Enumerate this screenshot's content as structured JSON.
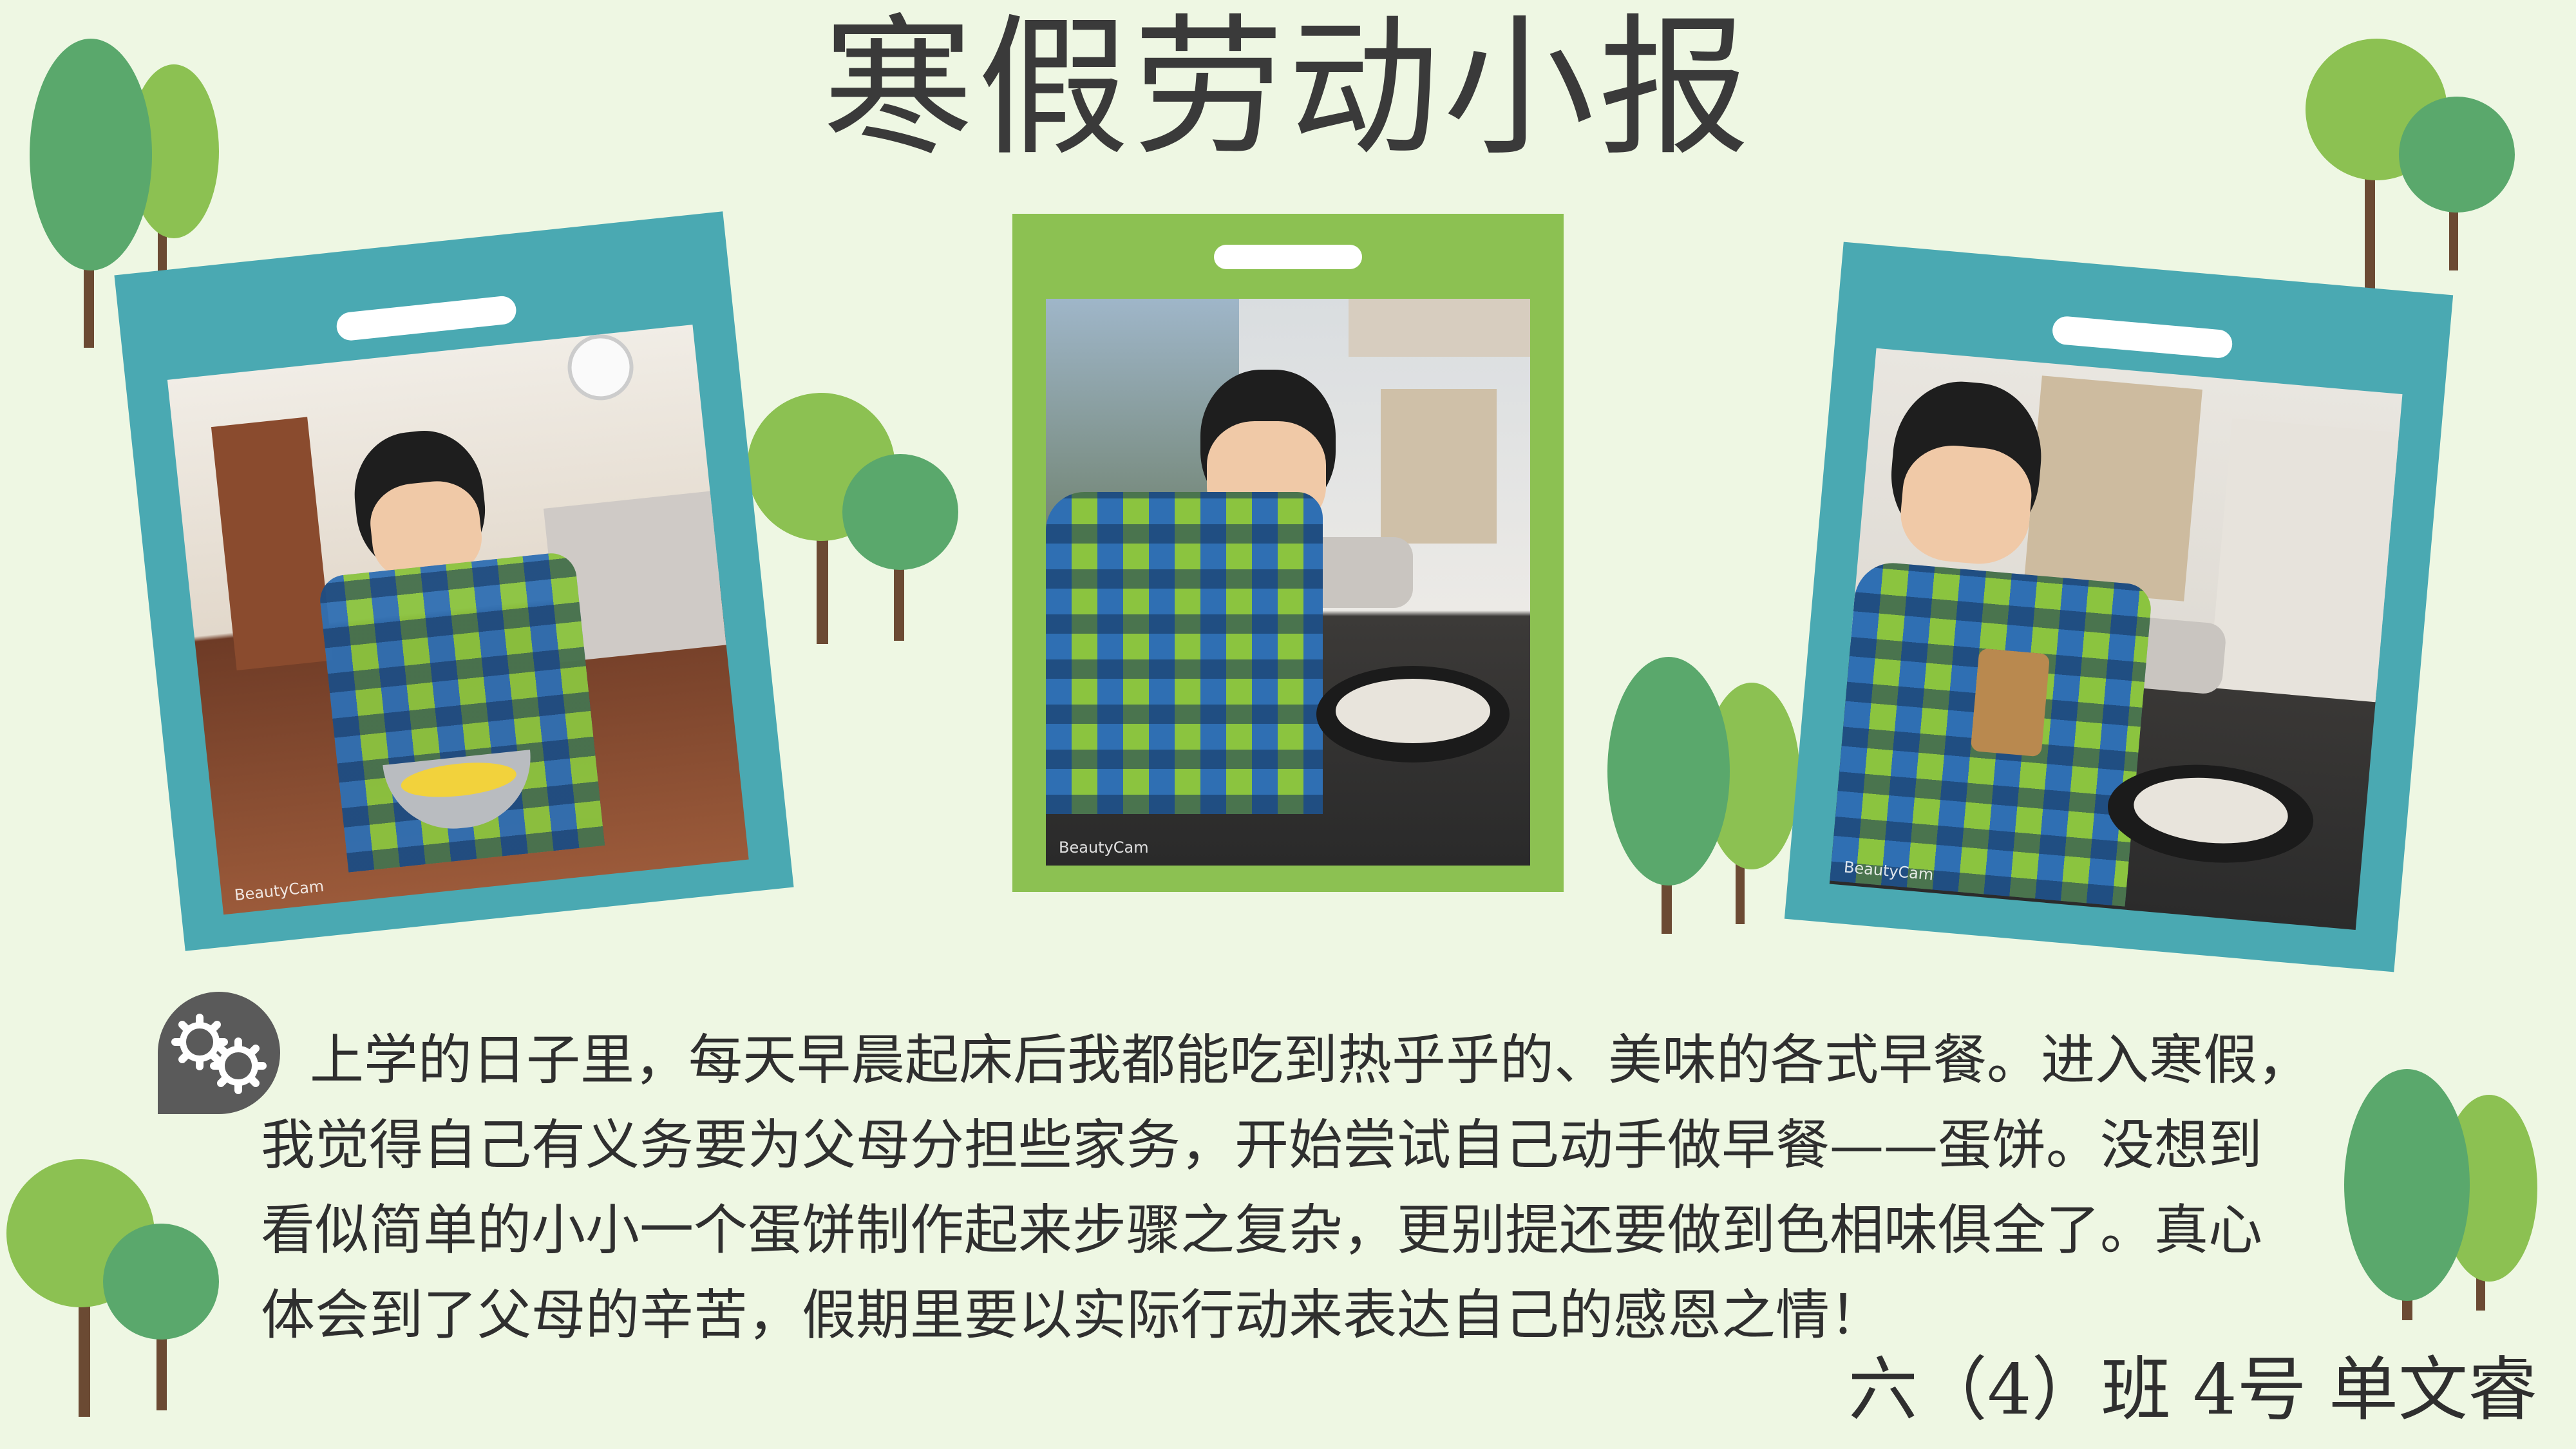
{
  "title": "寒假劳动小报",
  "paragraph": "上学的日子里，每天早晨起床后我都能吃到热乎乎的、美味的各式早餐。进入寒假，我觉得自己有义务要为父母分担些家务，开始尝试自己动手做早餐——蛋饼。没想到看似简单的小小一个蛋饼制作起来步骤之复杂，更别提还要做到色相味俱全了。真心体会到了父母的辛苦，假期里要以实际行动来表达自己的感恩之情！",
  "author": "六（4）班 4号 单文睿",
  "photos": [
    {
      "watermark": "BeautyCam",
      "frame_color": "#4aa9b2"
    },
    {
      "watermark": "BeautyCam",
      "frame_color": "#8cc152"
    },
    {
      "watermark": "BeautyCam",
      "frame_color": "#4aa9b2"
    }
  ],
  "icons": {
    "gears": "gears-icon"
  },
  "colors": {
    "background": "#eef7e3",
    "tree_dark": "#5aa86c",
    "tree_light": "#8cc152",
    "frame_teal": "#4aa9b2",
    "frame_green": "#8cc152"
  }
}
